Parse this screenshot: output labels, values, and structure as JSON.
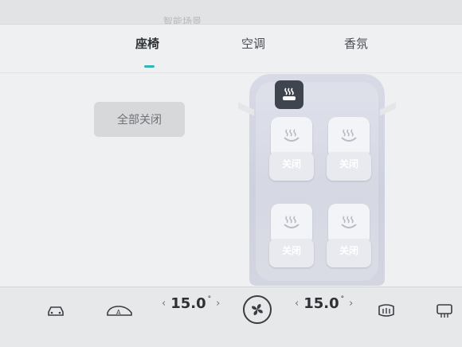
{
  "header": {
    "ghost_text": "智能场景"
  },
  "tabs": [
    {
      "label": "座椅",
      "active": true
    },
    {
      "label": "空调",
      "active": false
    },
    {
      "label": "香氛",
      "active": false
    }
  ],
  "controls": {
    "all_off_label": "全部关闭"
  },
  "seats": [
    {
      "position": "front-left",
      "status": "关闭"
    },
    {
      "position": "front-right",
      "status": "关闭"
    },
    {
      "position": "rear-left",
      "status": "关闭"
    },
    {
      "position": "rear-right",
      "status": "关闭"
    }
  ],
  "bottom_bar": {
    "left_temp": "15.0",
    "right_temp": "15.0",
    "temp_unit": "°",
    "arrow_left": "‹",
    "arrow_right": "›"
  },
  "colors": {
    "accent": "#2fb5b2",
    "badge_bg": "#3f454f"
  }
}
